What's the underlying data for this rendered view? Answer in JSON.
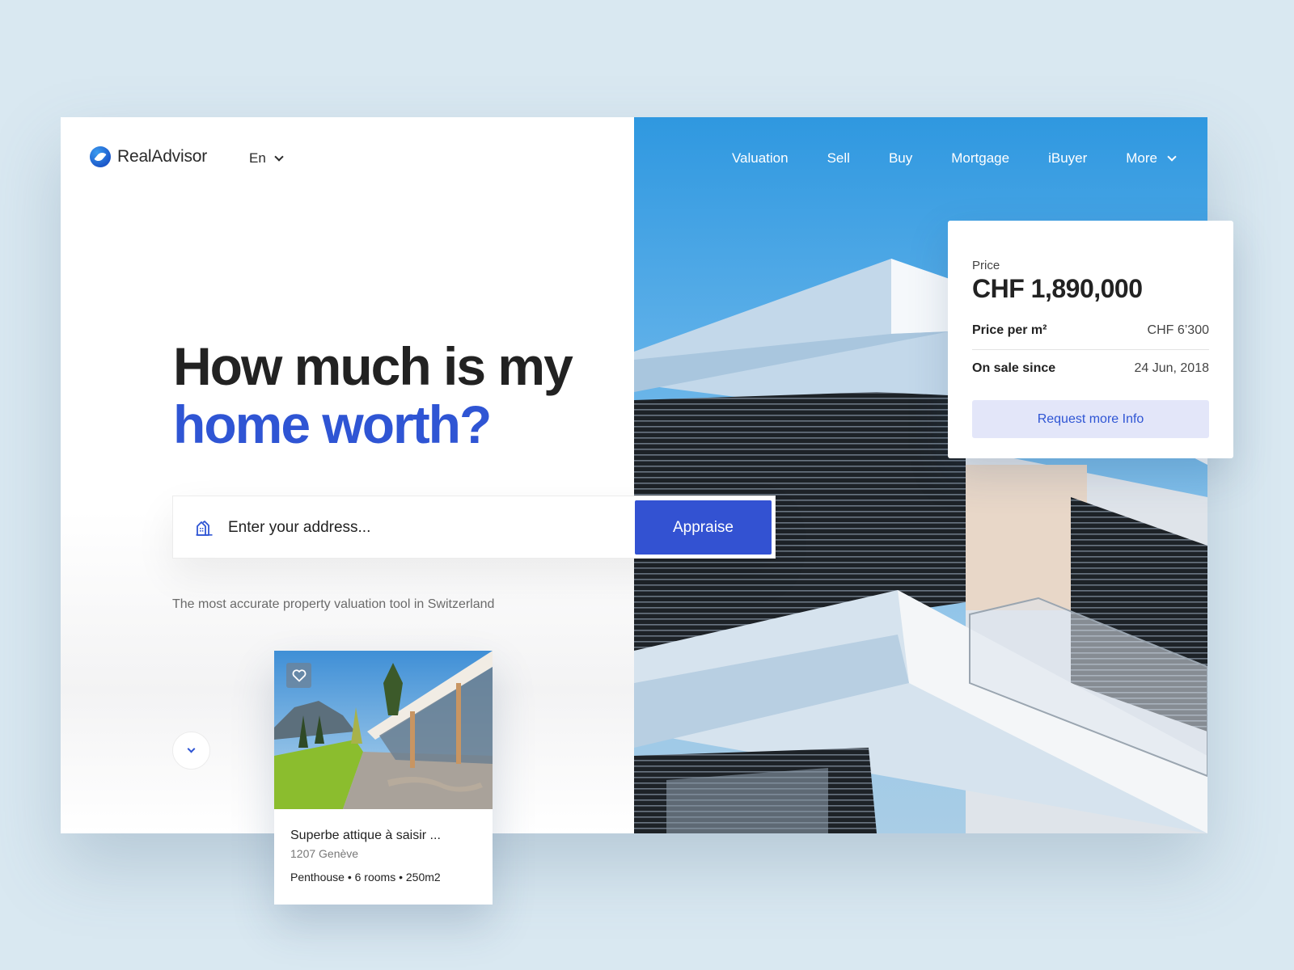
{
  "brand": {
    "name": "RealAdvisor",
    "accent": "#2f55d4"
  },
  "language": {
    "selected": "En"
  },
  "nav": {
    "items": [
      "Valuation",
      "Sell",
      "Buy",
      "Mortgage",
      "iBuyer"
    ],
    "more_label": "More"
  },
  "hero": {
    "title_line1": "How much is my",
    "title_line2": "home worth?",
    "tagline": "The most accurate property valuation tool in Switzerland"
  },
  "search": {
    "placeholder": "Enter your address...",
    "value": "",
    "button_label": "Appraise"
  },
  "price_card": {
    "price_label": "Price",
    "price_value": "CHF 1,890,000",
    "rows": [
      {
        "key": "Price per m²",
        "value": "CHF 6’300"
      },
      {
        "key": "On sale since",
        "value": "24 Jun, 2018"
      }
    ],
    "button_label": "Request more Info"
  },
  "listing": {
    "title": "Superbe attique à saisir ...",
    "location": "1207 Genève",
    "meta": "Penthouse • 6 rooms • 250m2",
    "favorited": false
  }
}
